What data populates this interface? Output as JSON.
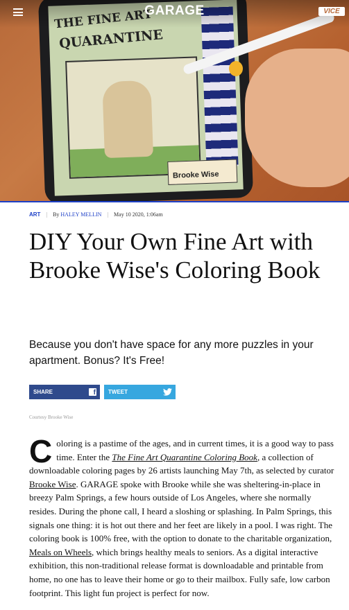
{
  "header": {
    "brand": "GARAGE",
    "partner_logo": "VICE",
    "menu_icon": "hamburger-menu-icon"
  },
  "hero": {
    "screen_title_line1": "THE FINE ART",
    "screen_title_line2": "QUARANTINE",
    "credit_text": "Brooke Wise"
  },
  "article": {
    "category": "ART",
    "byline_prefix": "By",
    "author": "HALEY MELLIN",
    "date": "May 10 2020, 1:06am",
    "headline": "DIY Your Own Fine Art with Brooke Wise's Coloring Book",
    "dek": "Because you don't have space for any more puzzles in your apartment. Bonus? It's Free!",
    "share_label": "SHARE",
    "tweet_label": "TWEET",
    "caption": "Courtesy Brooke Wise",
    "dropcap": "C",
    "body_p1_a": "oloring is a pastime of the ages, and in current times, it is a good way to pass time. Enter the ",
    "link_book": "The Fine Art Quarantine Coloring Book",
    "body_p1_b": ", a collection of downloadable coloring pages by 26 artists launching May 7th, as selected by curator ",
    "link_curator": "Brooke Wise",
    "body_p1_c": ". GARAGE spoke with Brooke while she was sheltering-in-place in breezy Palm Springs, a few hours outside of Los Angeles, where she normally resides. During the phone call, I heard a sloshing or splashing. In Palm Springs, this signals one thing: it is hot out there and her feet are likely in a pool. I was right. The coloring book is 100% free, with the option to donate to the charitable organization, ",
    "link_charity": "Meals on Wheels",
    "body_p1_d": ", which brings healthy meals to seniors. As a digital interactive exhibition, this non-traditional release format is downloadable and printable from home, no one has to leave their home or go to their mailbox. Fully safe, low carbon footprint. This light fun project is perfect for now."
  },
  "colors": {
    "accent_blue": "#1c3fc7",
    "facebook_blue": "#2f4a8c",
    "twitter_blue": "#37a7df"
  }
}
